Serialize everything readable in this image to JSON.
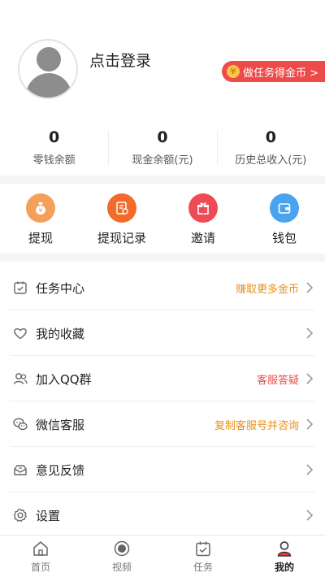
{
  "profile": {
    "login_label": "点击登录",
    "task_badge": "做任务得金币 >",
    "coin_symbol": "¥"
  },
  "stats": [
    {
      "value": "0",
      "label": "零钱余额"
    },
    {
      "value": "0",
      "label": "现金余额(元)"
    },
    {
      "value": "0",
      "label": "历史总收入(元)"
    }
  ],
  "actions": [
    {
      "label": "提现",
      "icon": "money-bag-icon",
      "color": "#f5a05a"
    },
    {
      "label": "提现记录",
      "icon": "record-icon",
      "color": "#f36b2b"
    },
    {
      "label": "邀请",
      "icon": "gift-icon",
      "color": "#ef4a55"
    },
    {
      "label": "钱包",
      "icon": "wallet-icon",
      "color": "#4aa3f0"
    }
  ],
  "menu": [
    {
      "label": "任务中心",
      "extra": "赚取更多金币",
      "extra_color": "#e8901a",
      "icon": "task-check-icon"
    },
    {
      "label": "我的收藏",
      "extra": "",
      "extra_color": "",
      "icon": "heart-icon"
    },
    {
      "label": "加入QQ群",
      "extra": "客服答疑",
      "extra_color": "#e84d4d",
      "icon": "group-icon"
    },
    {
      "label": "微信客服",
      "extra": "复制客服号并咨询",
      "extra_color": "#e8901a",
      "icon": "wechat-icon"
    },
    {
      "label": "意见反馈",
      "extra": "",
      "extra_color": "",
      "icon": "feedback-icon"
    },
    {
      "label": "设置",
      "extra": "",
      "extra_color": "",
      "icon": "gear-icon"
    }
  ],
  "tabbar": [
    {
      "label": "首页",
      "icon": "home-icon",
      "active": false
    },
    {
      "label": "视频",
      "icon": "video-icon",
      "active": false
    },
    {
      "label": "任务",
      "icon": "task-icon",
      "active": false
    },
    {
      "label": "我的",
      "icon": "profile-icon",
      "active": true
    }
  ],
  "colors": {
    "accent_red": "#ee4a4a",
    "orange_text": "#e8901a"
  }
}
